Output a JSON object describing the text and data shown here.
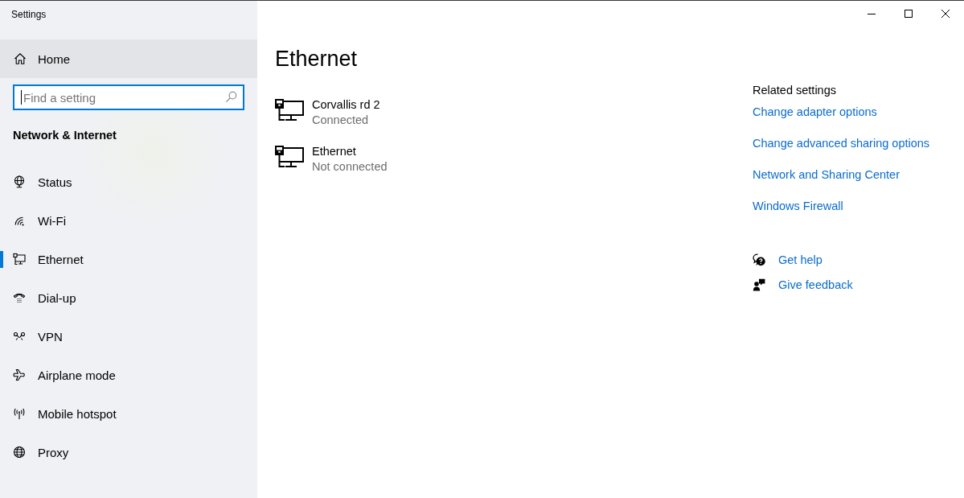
{
  "window": {
    "title": "Settings"
  },
  "sidebar": {
    "home": {
      "label": "Home",
      "highlighted": true
    },
    "search": {
      "placeholder": "Find a setting",
      "focused": true
    },
    "section_title": "Network & Internet",
    "items": [
      {
        "label": "Status",
        "selected": false
      },
      {
        "label": "Wi-Fi",
        "selected": false
      },
      {
        "label": "Ethernet",
        "selected": true
      },
      {
        "label": "Dial-up",
        "selected": false
      },
      {
        "label": "VPN",
        "selected": false
      },
      {
        "label": "Airplane mode",
        "selected": false
      },
      {
        "label": "Mobile hotspot",
        "selected": false
      },
      {
        "label": "Proxy",
        "selected": false
      }
    ]
  },
  "page": {
    "title": "Ethernet",
    "networks": [
      {
        "name": "Corvallis rd 2",
        "status": "Connected"
      },
      {
        "name": "Ethernet",
        "status": "Not connected"
      }
    ]
  },
  "related_settings": {
    "heading": "Related settings",
    "links": [
      "Change adapter options",
      "Change advanced sharing options",
      "Network and Sharing Center",
      "Windows Firewall"
    ]
  },
  "help_links": [
    "Get help",
    "Give feedback"
  ]
}
